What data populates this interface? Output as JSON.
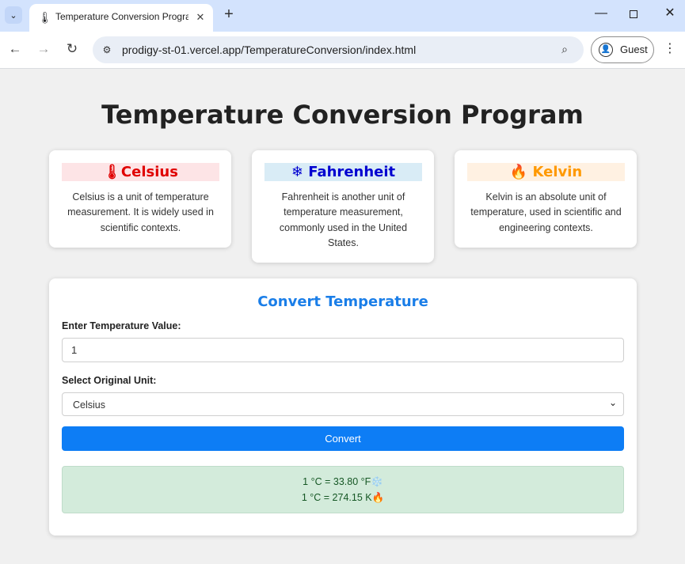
{
  "browser": {
    "tab_title": "Temperature Conversion Program",
    "tab_favicon": "🌡",
    "tab_search_glyph": "⌄",
    "close_glyph": "✕",
    "newtab_glyph": "+",
    "url": "prodigy-st-01.vercel.app/TemperatureConversion/index.html",
    "profile_label": "Guest",
    "back_glyph": "←",
    "forward_glyph": "→",
    "reload_glyph": "↻",
    "menu_glyph": "⋮",
    "zoom_glyph": "⌕",
    "minimize_glyph": "—",
    "site_info_glyph": "⚙",
    "profile_glyph": "👤"
  },
  "page": {
    "title": "Temperature Conversion Program"
  },
  "cards": [
    {
      "icon": "🌡",
      "title": "Celsius",
      "description": "Celsius is a unit of temperature measurement. It is widely used in scientific contexts.",
      "color": "#e00000",
      "bg": "#fde4e6"
    },
    {
      "icon": "❄",
      "title": "Fahrenheit",
      "description": "Fahrenheit is another unit of temperature measurement, commonly used in the United States.",
      "color": "#0000d0",
      "bg": "#d9ecf6"
    },
    {
      "icon": "🔥",
      "title": "Kelvin",
      "description": "Kelvin is an absolute unit of temperature, used in scientific and engineering contexts.",
      "color": "#ff9900",
      "bg": "#fff1e2"
    }
  ],
  "converter": {
    "title": "Convert Temperature",
    "value_label": "Enter Temperature Value:",
    "value": "1",
    "unit_label": "Select Original Unit:",
    "unit_selected": "Celsius",
    "chevron_glyph": "⌄",
    "button_label": "Convert",
    "results": [
      "1 °C = 33.80 °F❄️",
      "1 °C = 274.15 K🔥"
    ]
  },
  "colors": {
    "accent": "#0d7df5",
    "result_bg": "#d3ebdb",
    "result_text": "#155724"
  }
}
